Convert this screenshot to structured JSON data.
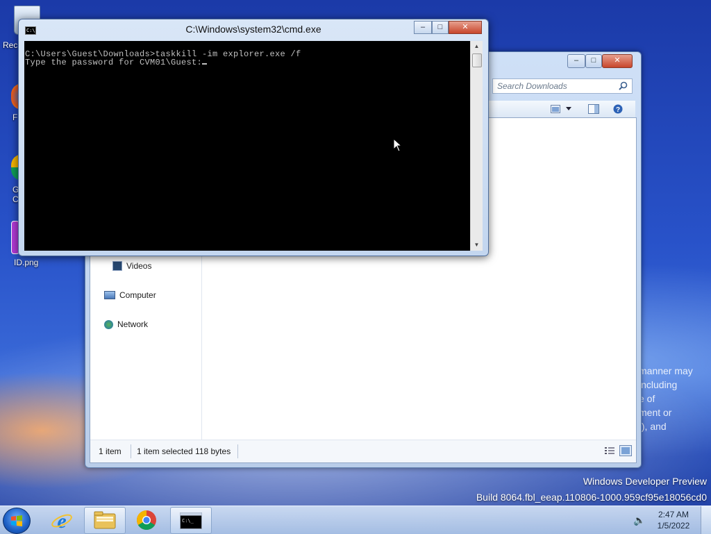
{
  "desktop": {
    "icons": [
      {
        "label": "Rec"
      },
      {
        "label": "F"
      },
      {
        "label": "G\nC"
      },
      {
        "label": "ID.png"
      }
    ],
    "background_text": [
      "manner may",
      "including",
      "e of",
      "ment or",
      "f), and"
    ],
    "watermark": {
      "line1": "Windows Developer Preview",
      "line2": "Build 8064.fbl_eeap.110806-1000.959cf95e18056cd0"
    }
  },
  "explorer": {
    "search_placeholder": "Search Downloads",
    "nav": {
      "videos": "Videos",
      "computer": "Computer",
      "network": "Network"
    },
    "status": {
      "count": "1 item",
      "selected": "1 item selected 118 bytes"
    },
    "controls": {
      "minimize": "–",
      "maximize": "□",
      "close": "✕"
    }
  },
  "cmd": {
    "title": "C:\\Windows\\system32\\cmd.exe",
    "icon_text": "C:\\",
    "lines": [
      "C:\\Users\\Guest\\Downloads>taskkill -im explorer.exe /f",
      "Type the password for CVM01\\Guest:"
    ],
    "controls": {
      "minimize": "–",
      "maximize": "□",
      "close": "✕"
    },
    "scroll_up": "▲",
    "scroll_down": "▼"
  },
  "taskbar": {
    "items": [
      {
        "name": "internet-explorer"
      },
      {
        "name": "file-explorer"
      },
      {
        "name": "chrome"
      },
      {
        "name": "cmd"
      }
    ],
    "clock": {
      "time": "2:47 AM",
      "date": "1/5/2022"
    },
    "speaker_icon": "🔈"
  },
  "colors": {
    "console_bg": "#000000",
    "console_text": "#c0c0c0",
    "close_button": "#c8462b"
  }
}
